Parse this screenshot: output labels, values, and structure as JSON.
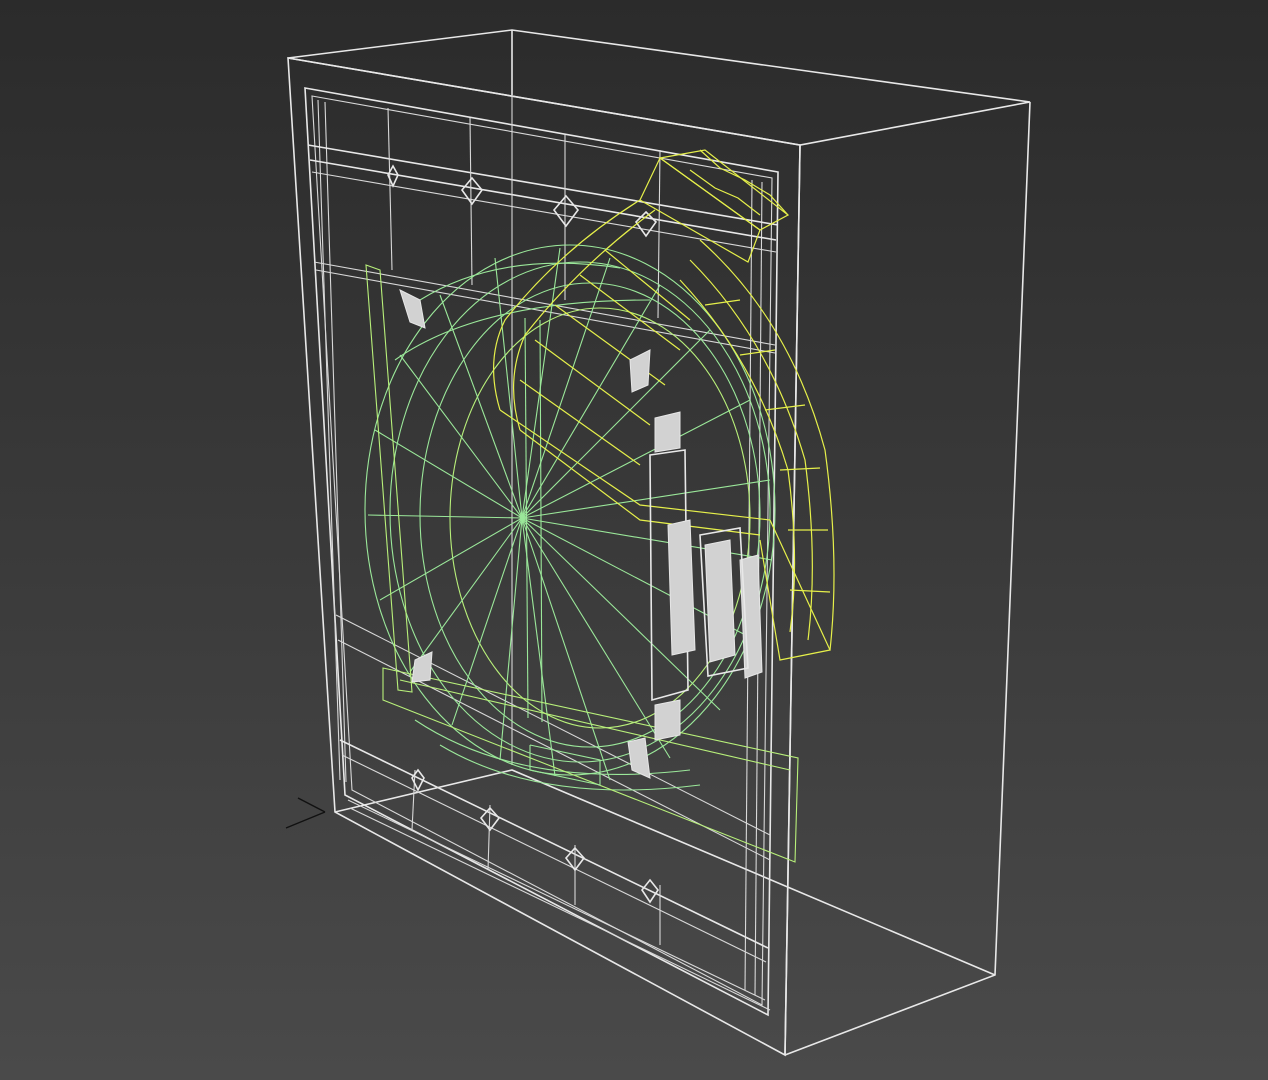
{
  "viewport": {
    "background_top": "#2b2b2b",
    "background_bottom": "#4a4a4a",
    "render_mode": "wireframe"
  },
  "object": {
    "kind": "washing-machine",
    "colors": {
      "body": "#e8e8e8",
      "drum": "#9be89a",
      "door_rim": "#e6f04a",
      "fittings": "#d2d2d2"
    }
  },
  "gizmo": {
    "icon": "axis-tripod-icon"
  }
}
